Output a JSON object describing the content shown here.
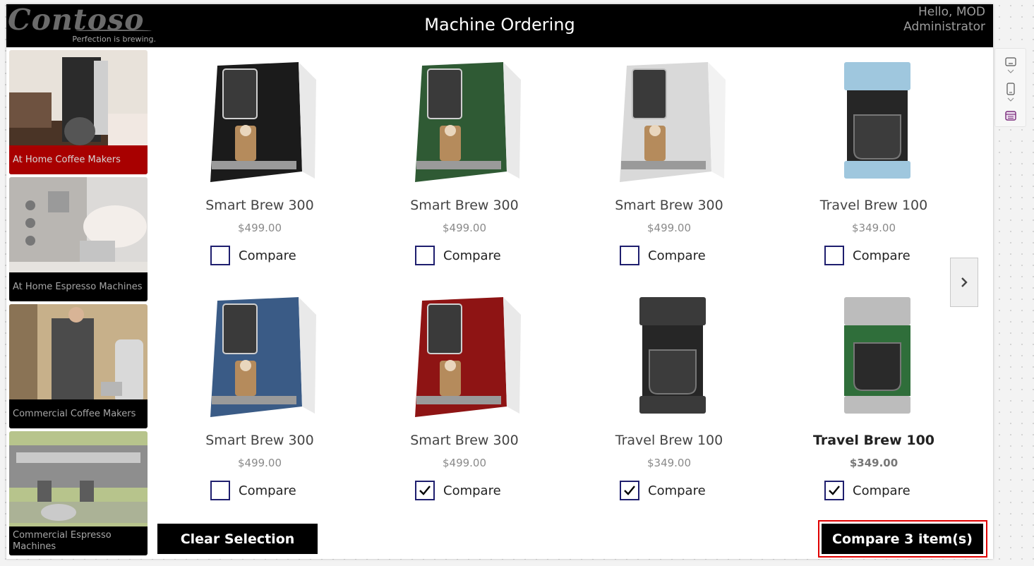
{
  "header": {
    "logo_text": "Contoso",
    "tagline": "Perfection is brewing.",
    "title": "Machine Ordering",
    "greeting_line1": "Hello, MOD",
    "greeting_line2": "Administrator"
  },
  "categories": [
    {
      "label": "At Home Coffee Makers",
      "active": true
    },
    {
      "label": "At Home Espresso Machines",
      "active": false
    },
    {
      "label": "Commercial Coffee Makers",
      "active": false
    },
    {
      "label": "Commercial Espresso Machines",
      "active": false
    }
  ],
  "products": [
    {
      "name": "Smart Brew 300",
      "price": "$499.00",
      "compare_label": "Compare",
      "checked": false,
      "image": "espresso-black"
    },
    {
      "name": "Smart Brew 300",
      "price": "$499.00",
      "compare_label": "Compare",
      "checked": false,
      "image": "espresso-green"
    },
    {
      "name": "Smart Brew 300",
      "price": "$499.00",
      "compare_label": "Compare",
      "checked": false,
      "image": "espresso-white"
    },
    {
      "name": "Travel Brew 100",
      "price": "$349.00",
      "compare_label": "Compare",
      "checked": false,
      "image": "drip-blue"
    },
    {
      "name": "Smart Brew 300",
      "price": "$499.00",
      "compare_label": "Compare",
      "checked": false,
      "image": "espresso-blue"
    },
    {
      "name": "Smart Brew 300",
      "price": "$499.00",
      "compare_label": "Compare",
      "checked": true,
      "image": "espresso-red"
    },
    {
      "name": "Travel Brew 100",
      "price": "$349.00",
      "compare_label": "Compare",
      "checked": true,
      "image": "drip-black"
    },
    {
      "name": "Travel Brew 100",
      "price": "$349.00",
      "compare_label": "Compare",
      "checked": true,
      "image": "drip-green"
    }
  ],
  "buttons": {
    "clear_label": "Clear Selection",
    "compare_label": "Compare 3 item(s)"
  },
  "icons": {
    "next": "chevron-right-icon",
    "tools": [
      "screen-size-icon",
      "phone-icon",
      "data-table-icon"
    ]
  },
  "colors": {
    "header_bg": "#000000",
    "active_category": "#a80000",
    "checkbox_border": "#1e1e6e",
    "highlight_outline": "#e00000",
    "accent_tool": "#7a2c7c"
  }
}
